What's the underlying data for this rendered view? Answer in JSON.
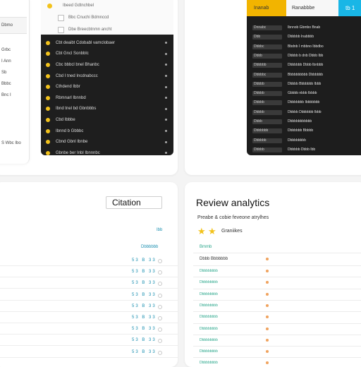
{
  "side_panel": {
    "header": "Dbmo",
    "items": [
      "Grbc",
      "I Ann",
      "Sb",
      "Bbbc",
      "Bnc I"
    ],
    "footer": "S Wbc Ibo"
  },
  "task_list": {
    "light_rows": [
      "Ibeed Gdtnchbel",
      "Bbc Cnuchi Bdmnccd",
      "Dbe Breecbtnmn ancht"
    ],
    "rows": [
      "Cbt deaibt Cdobabl vamclobaer",
      "Cbt Gncl Sonbblc",
      "Cbc bbbcl bnel Bhanbc",
      "Cbd I tned Incdnabccc",
      "Cthdend Ibbr",
      "Rbmnarl Ibnnbd",
      "Ibnd tnel bd Gbnbbbs",
      "Cbd Ibbbe",
      "Ibnnd b Gbbbc",
      "Cbnd Gbnl Ibnbe",
      "Gbnbe ber Inbl Ibnnnbc"
    ]
  },
  "data_table": {
    "header": [
      "Inanab",
      "Ranabbbe",
      "tb 1"
    ],
    "rows": [
      [
        "Dnnabc",
        "Ibnnob Gbmbo Bnab"
      ],
      [
        "Dbb",
        "Dbbbbb Inabbbb"
      ],
      [
        "Dbbbc",
        "Bbdnb I mbbno Ibbdbo"
      ],
      [
        "Dbbb",
        "Dbbbb b dnb Dbbb Ibb"
      ],
      [
        "Dbbbbb",
        "Dbbbbbb Dbbb Ibnbbb"
      ],
      [
        "Dbbbbc",
        "Bbbbbbbbbb Dbbbbbb"
      ],
      [
        "Dbbbb",
        "Dbbbb Bbbbbbb Ibbb"
      ],
      [
        "Dbbbb",
        "Gbbbb nbbb Ibbbb"
      ],
      [
        "Dbbbb",
        "Dbbbbbbb Ibbbbbbb"
      ],
      [
        "Dbbbb",
        "Dbbbb Dbbbbbb Ibbb"
      ],
      [
        "Dbbb",
        "Dbbbbbbbbbbb"
      ],
      [
        "Dbbbbbb",
        "Dbbbbbb Bbbbb"
      ],
      [
        "Dbbbbb",
        "Dbbbbbbbb"
      ],
      [
        "Dbbbb",
        "Dbbbbb Dbbb Ibb"
      ]
    ]
  },
  "citation": {
    "title": "Citation",
    "col_header": "Ibb",
    "sub_header": "Dbbbbbb",
    "rows": [
      "53 B 33",
      "53 B 33",
      "53 B 33",
      "53 B 33",
      "53 B 33",
      "53 B 33",
      "53 B 33",
      "53 B 33",
      "53 B 33"
    ]
  },
  "review_analytics": {
    "title": "Review analytics",
    "subtitle": "Preabe & cobie feveone atrylhes",
    "stars_label": "Graniikes",
    "col_header": "Bmmb",
    "first_row": "Dbbb Bbbbbbb",
    "rows": [
      "Dbbbbbbbb",
      "Dbbbbbbbb",
      "Dbbbbbbbb",
      "Dbbbbbbbb",
      "Dbbbbbbbb",
      "Dbbbbbbbb",
      "Dbbbbbbbb",
      "Dbbbbbbbb",
      "Dbbbbbbbb"
    ]
  },
  "colors": {
    "accent_yellow": "#f2c21b",
    "accent_blue": "#19b6e6",
    "dark_bg": "#1e1e1e",
    "teal_text": "#28a68a",
    "orange_dot": "#f0a35e"
  }
}
